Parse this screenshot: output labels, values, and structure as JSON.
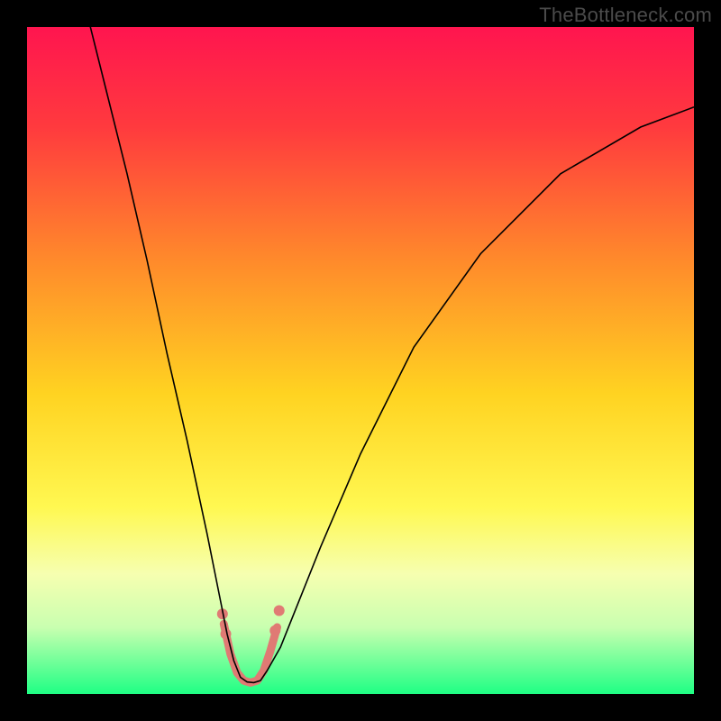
{
  "watermark": "TheBottleneck.com",
  "chart_data": {
    "type": "line",
    "title": "",
    "xlabel": "",
    "ylabel": "",
    "xlim": [
      0,
      100
    ],
    "ylim": [
      0,
      100
    ],
    "grid": false,
    "legend": false,
    "background_gradient": {
      "stops": [
        {
          "offset": 0.0,
          "color": "#ff154f"
        },
        {
          "offset": 0.15,
          "color": "#ff3a3e"
        },
        {
          "offset": 0.35,
          "color": "#ff8a2b"
        },
        {
          "offset": 0.55,
          "color": "#ffd321"
        },
        {
          "offset": 0.72,
          "color": "#fff851"
        },
        {
          "offset": 0.82,
          "color": "#f6ffb0"
        },
        {
          "offset": 0.9,
          "color": "#c9ffb0"
        },
        {
          "offset": 1.0,
          "color": "#1fff84"
        }
      ]
    },
    "series": [
      {
        "name": "main-curve",
        "type": "line",
        "color": "#000000",
        "width": 1.6,
        "x": [
          9,
          10,
          12,
          15,
          18,
          21,
          24,
          27,
          29,
          30,
          31,
          32,
          33,
          34,
          35,
          36,
          38,
          40,
          44,
          50,
          58,
          68,
          80,
          92,
          100
        ],
        "y": [
          102,
          98,
          90,
          78,
          65,
          51,
          38,
          24,
          14,
          9,
          5,
          2.5,
          1.8,
          1.7,
          2.0,
          3.5,
          7,
          12,
          22,
          36,
          52,
          66,
          78,
          85,
          88
        ]
      },
      {
        "name": "highlight-band",
        "type": "line",
        "color": "#e07a74",
        "width": 9,
        "linecap": "round",
        "x": [
          29.5,
          30.5,
          31.5,
          32.5,
          33.5,
          34.5,
          35.5,
          36.5,
          37.5
        ],
        "y": [
          10.5,
          6.0,
          3.2,
          2.0,
          1.7,
          2.0,
          3.5,
          6.5,
          10.0
        ]
      },
      {
        "name": "highlight-blob-left",
        "type": "scatter",
        "color": "#e07a74",
        "radius": 6,
        "x": [
          29.3,
          29.8
        ],
        "y": [
          12.0,
          9.0
        ]
      },
      {
        "name": "highlight-blob-right",
        "type": "scatter",
        "color": "#e07a74",
        "radius": 6,
        "x": [
          37.2,
          37.8
        ],
        "y": [
          9.5,
          12.5
        ]
      }
    ]
  }
}
